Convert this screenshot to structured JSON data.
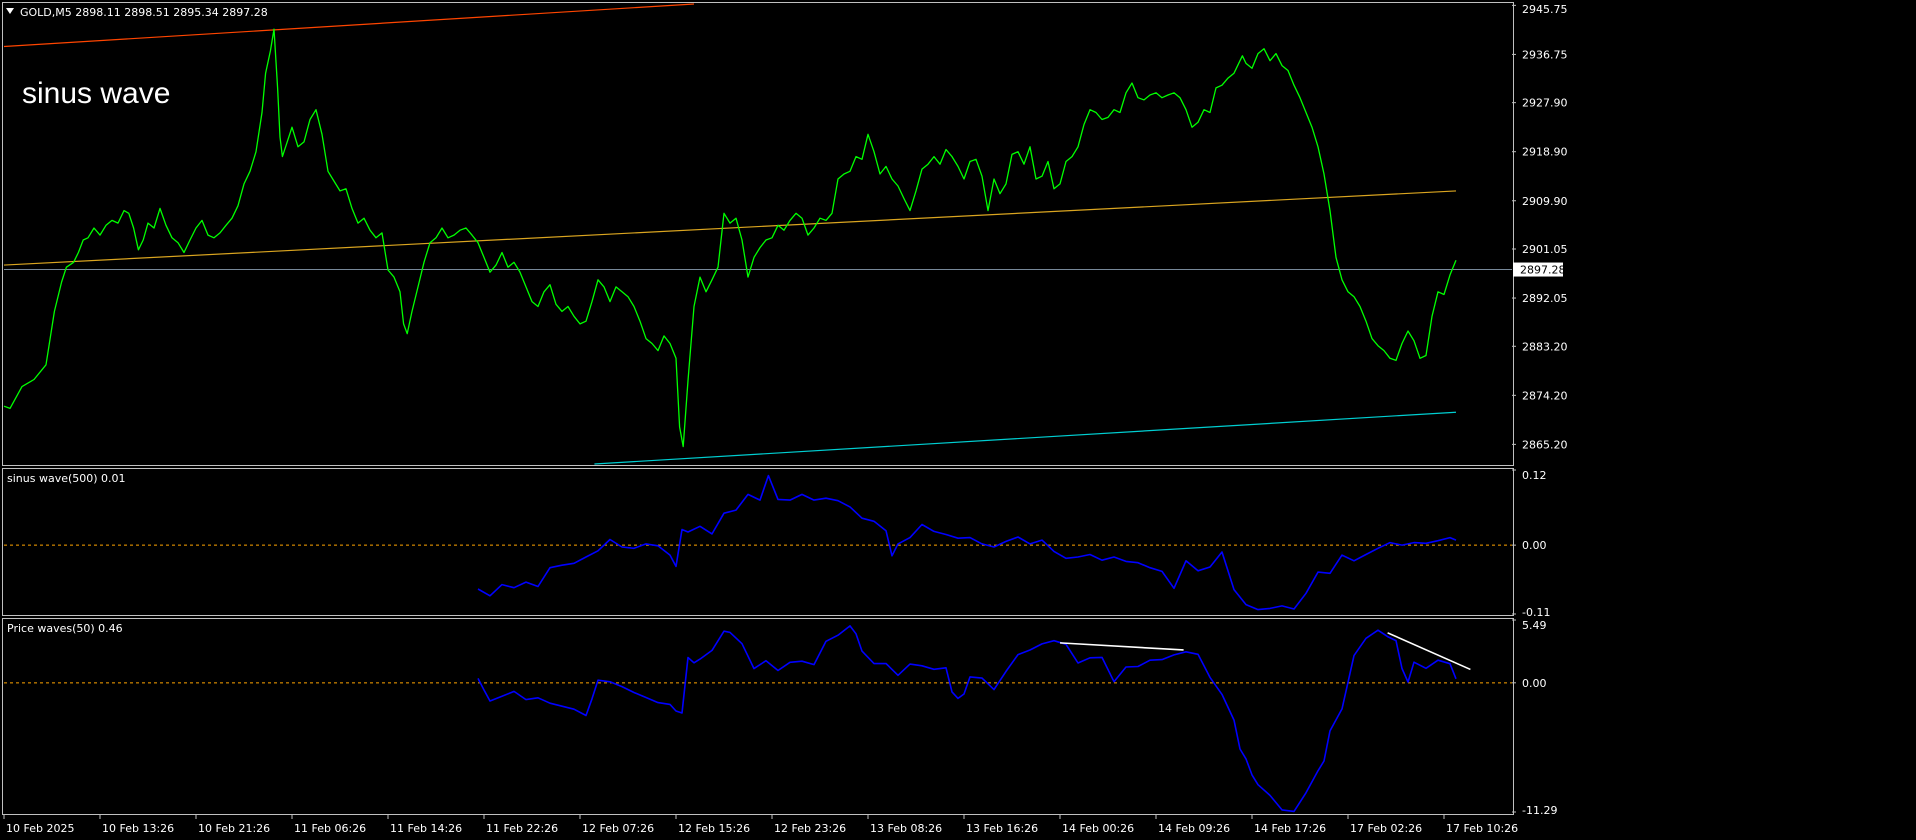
{
  "header": {
    "symbol_line": "GOLD,M5  2898.11 2898.51 2895.34 2897.28",
    "indicator_title": "sinus wave"
  },
  "colors": {
    "background": "#000000",
    "price": "#00ff00",
    "indicator": "#0000ff",
    "zero_line": "#ffa500",
    "divergence": "#ffffff",
    "resistance": "#ff4500",
    "midline": "#daa520",
    "support": "#00ced1",
    "current_price_line": "#778899"
  },
  "x_axis": {
    "labels": [
      "10 Feb 2025",
      "10 Feb 13:26",
      "10 Feb 21:26",
      "11 Feb 06:26",
      "11 Feb 14:26",
      "11 Feb 22:26",
      "12 Feb 07:26",
      "12 Feb 15:26",
      "12 Feb 23:26",
      "13 Feb 08:26",
      "13 Feb 16:26",
      "14 Feb 00:26",
      "14 Feb 09:26",
      "14 Feb 17:26",
      "17 Feb 02:26",
      "17 Feb 10:26"
    ]
  },
  "chart_data": [
    {
      "type": "line",
      "name": "main",
      "title": "GOLD,M5  2898.11 2898.51 2895.34 2897.28",
      "ylim": [
        2861.6,
        2946.0
      ],
      "y_ticks": [
        "2945.75",
        "2936.75",
        "2927.90",
        "2918.90",
        "2909.90",
        "2901.05",
        "2892.05",
        "2883.20",
        "2874.20",
        "2865.20"
      ],
      "current_price": "2897.28",
      "x": [
        0,
        5,
        15,
        25,
        35,
        42,
        48,
        52,
        58,
        62,
        66,
        70,
        75,
        80,
        85,
        90,
        95,
        100,
        104,
        108,
        112,
        116,
        120,
        125,
        130,
        135,
        140,
        145,
        150,
        155,
        160,
        165,
        170,
        175,
        180,
        185,
        190,
        195,
        200,
        205,
        210,
        215,
        218,
        222,
        225,
        228,
        230,
        232,
        236,
        240,
        245,
        250,
        255,
        260,
        265,
        270,
        275,
        280,
        285,
        290,
        295,
        300,
        305,
        310,
        315,
        320,
        325,
        330,
        333,
        336,
        340,
        345,
        350,
        355,
        360,
        365,
        370,
        375,
        380,
        385,
        390,
        395,
        400,
        405,
        410,
        415,
        420,
        425,
        430,
        435,
        440,
        445,
        450,
        455,
        460,
        465,
        470,
        475,
        480,
        485,
        490,
        495,
        500,
        505,
        510,
        515,
        520,
        525,
        530,
        535,
        540,
        545,
        550,
        555,
        560,
        563,
        566,
        570,
        575,
        580,
        585,
        590,
        595,
        600,
        605,
        610,
        615,
        620,
        625,
        630,
        635,
        640,
        645,
        650,
        655,
        660,
        665,
        670,
        675,
        680,
        685,
        690,
        695,
        700,
        705,
        710,
        715,
        720,
        725,
        730,
        735,
        740,
        745,
        750,
        755,
        760,
        765,
        770,
        775,
        780,
        785,
        790,
        795,
        800,
        805,
        810,
        815,
        820,
        825,
        830,
        835,
        840,
        845,
        850,
        855,
        860,
        865,
        870,
        875,
        880,
        885,
        890,
        895,
        900,
        905,
        910,
        915,
        920,
        925,
        930,
        935,
        940,
        945,
        950,
        955,
        960,
        965,
        970,
        975,
        980,
        985,
        990,
        995,
        1000,
        1005,
        1010,
        1015,
        1020,
        1025,
        1030,
        1032,
        1035,
        1040,
        1045,
        1050,
        1055,
        1060,
        1065,
        1070,
        1075,
        1080,
        1085,
        1090,
        1095,
        1100,
        1105,
        1110,
        1115,
        1120,
        1125,
        1130,
        1135,
        1140,
        1145,
        1150,
        1155,
        1160,
        1165,
        1170,
        1175,
        1180,
        1185,
        1190,
        1195,
        1200,
        1205,
        1210
      ],
      "series": [
        {
          "values": [
            2872.2,
            2871.8,
            2875.8,
            2877.1,
            2879.8,
            2889.6,
            2895.0,
            2897.7,
            2898.6,
            2900.4,
            2902.7,
            2903.1,
            2904.9,
            2903.6,
            2905.4,
            2906.3,
            2905.8,
            2908.1,
            2907.6,
            2904.9,
            2900.9,
            2902.7,
            2905.8,
            2904.9,
            2908.5,
            2905.4,
            2903.1,
            2902.2,
            2900.4,
            2902.7,
            2904.9,
            2906.3,
            2903.6,
            2903.1,
            2904.0,
            2905.4,
            2906.7,
            2909.0,
            2913.0,
            2915.3,
            2918.9,
            2926.1,
            2933.3,
            2937.4,
            2941.4,
            2930.6,
            2921.6,
            2918.0,
            2920.7,
            2923.4,
            2919.8,
            2920.7,
            2924.8,
            2926.6,
            2922.1,
            2915.3,
            2913.5,
            2911.7,
            2912.1,
            2908.5,
            2905.8,
            2906.7,
            2904.5,
            2903.1,
            2904.0,
            2897.2,
            2895.9,
            2893.2,
            2887.3,
            2885.5,
            2889.6,
            2894.1,
            2898.6,
            2902.2,
            2903.1,
            2904.9,
            2903.1,
            2903.6,
            2904.5,
            2904.9,
            2903.6,
            2902.2,
            2899.5,
            2896.8,
            2898.1,
            2900.4,
            2897.7,
            2898.6,
            2896.8,
            2894.1,
            2891.4,
            2890.5,
            2893.2,
            2894.5,
            2890.9,
            2889.6,
            2890.5,
            2888.7,
            2887.3,
            2887.8,
            2891.4,
            2895.4,
            2894.1,
            2891.4,
            2894.1,
            2893.2,
            2892.3,
            2890.5,
            2887.8,
            2884.6,
            2883.7,
            2882.4,
            2885.1,
            2883.7,
            2881.0,
            2868.4,
            2864.8,
            2876.9,
            2890.5,
            2895.9,
            2893.2,
            2895.4,
            2897.7,
            2907.6,
            2905.8,
            2906.7,
            2902.7,
            2895.9,
            2899.5,
            2901.3,
            2902.7,
            2903.1,
            2905.4,
            2904.5,
            2906.3,
            2907.6,
            2906.7,
            2903.6,
            2904.9,
            2906.7,
            2906.3,
            2907.6,
            2913.9,
            2914.8,
            2915.3,
            2918.0,
            2917.5,
            2922.1,
            2918.9,
            2914.8,
            2916.2,
            2913.9,
            2912.6,
            2910.3,
            2908.1,
            2911.7,
            2915.7,
            2916.6,
            2918.0,
            2916.6,
            2919.3,
            2918.0,
            2916.2,
            2913.9,
            2917.1,
            2917.5,
            2914.4,
            2908.1,
            2913.9,
            2911.2,
            2913.0,
            2918.4,
            2918.9,
            2916.6,
            2919.8,
            2913.9,
            2914.4,
            2917.1,
            2912.1,
            2913.0,
            2917.1,
            2918.0,
            2919.8,
            2923.9,
            2926.6,
            2926.1,
            2924.8,
            2925.2,
            2926.6,
            2926.1,
            2929.7,
            2931.5,
            2928.8,
            2928.4,
            2929.3,
            2929.7,
            2928.8,
            2929.3,
            2929.7,
            2928.8,
            2926.6,
            2923.4,
            2924.3,
            2926.6,
            2926.1,
            2930.6,
            2931.1,
            2932.4,
            2933.3,
            2935.6,
            2936.5,
            2935.1,
            2934.2,
            2936.9,
            2937.8,
            2935.6,
            2936.9,
            2934.7,
            2933.8,
            2931.1,
            2928.8,
            2926.1,
            2923.4,
            2919.8,
            2914.8,
            2908.1,
            2899.5,
            2895.4,
            2893.2,
            2892.3,
            2890.5,
            2887.8,
            2884.6,
            2883.3,
            2882.4,
            2881.0,
            2880.6,
            2883.7,
            2886.0,
            2884.2,
            2881.0,
            2881.5,
            2888.7,
            2893.2,
            2892.7,
            2896.3,
            2899.0,
            2900.8,
            2902.2,
            2904.9,
            2903.1,
            2901.7,
            2899.9,
            2895.9,
            2897.2,
            2893.6,
            2898.6,
            2900.4,
            2899.5,
            2902.2,
            2902.2,
            2904.5,
            2903.1,
            2896.8
          ]
        }
      ],
      "trendlines": [
        {
          "name": "resistance",
          "x": [
            0,
            575
          ],
          "y": [
            2938.2,
            2946.0
          ]
        },
        {
          "name": "midline",
          "x": [
            0,
            1210
          ],
          "y": [
            2898.1,
            2911.7
          ]
        },
        {
          "name": "support",
          "x": [
            492,
            1210
          ],
          "y": [
            2861.6,
            2871.1
          ]
        }
      ]
    },
    {
      "type": "line",
      "name": "sinus_wave",
      "title": "sinus wave(500) 0.01",
      "ylim": [
        -0.11,
        0.12
      ],
      "y_ticks": [
        "0.12",
        "0.00",
        "-0.11"
      ],
      "zero_line": 0,
      "x": [
        395,
        405,
        415,
        425,
        435,
        445,
        455,
        465,
        475,
        485,
        495,
        505,
        515,
        525,
        535,
        545,
        555,
        560,
        565,
        570,
        580,
        590,
        600,
        610,
        620,
        630,
        637,
        645,
        655,
        665,
        675,
        685,
        695,
        705,
        715,
        725,
        735,
        740,
        745,
        755,
        765,
        775,
        785,
        795,
        805,
        815,
        825,
        835,
        845,
        855,
        865,
        875,
        885,
        895,
        905,
        915,
        925,
        935,
        945,
        955,
        965,
        975,
        985,
        995,
        1005,
        1015,
        1025,
        1035,
        1045,
        1055,
        1065,
        1075,
        1085,
        1095,
        1105,
        1115,
        1125,
        1135,
        1145,
        1155,
        1165,
        1175,
        1185,
        1195,
        1205,
        1210
      ],
      "series": [
        {
          "values": [
            -0.07,
            -0.081,
            -0.063,
            -0.068,
            -0.059,
            -0.066,
            -0.036,
            -0.032,
            -0.029,
            -0.019,
            -0.009,
            0.009,
            -0.003,
            -0.005,
            0.002,
            -0.001,
            -0.016,
            -0.034,
            0.025,
            0.021,
            0.03,
            0.018,
            0.051,
            0.056,
            0.081,
            0.072,
            0.111,
            0.073,
            0.072,
            0.081,
            0.072,
            0.075,
            0.071,
            0.061,
            0.043,
            0.038,
            0.023,
            -0.017,
            0.002,
            0.012,
            0.033,
            0.022,
            0.017,
            0.011,
            0.012,
            0.002,
            -0.003,
            0.006,
            0.013,
            0.002,
            0.008,
            -0.01,
            -0.021,
            -0.019,
            -0.015,
            -0.024,
            -0.019,
            -0.026,
            -0.028,
            -0.036,
            -0.042,
            -0.069,
            -0.025,
            -0.041,
            -0.035,
            -0.011,
            -0.071,
            -0.095,
            -0.103,
            -0.101,
            -0.097,
            -0.102,
            -0.077,
            -0.043,
            -0.045,
            -0.016,
            -0.025,
            -0.015,
            -0.005,
            0.004,
            0.0,
            0.004,
            0.003,
            0.007,
            0.012,
            0.008
          ]
        }
      ]
    },
    {
      "type": "line",
      "name": "price_waves",
      "title": "Price waves(50) 0.46",
      "ylim": [
        -11.29,
        5.49
      ],
      "y_ticks": [
        "5.49",
        "0.00",
        "-11.29"
      ],
      "zero_line": 0,
      "x": [
        395,
        400,
        405,
        415,
        425,
        435,
        445,
        455,
        465,
        475,
        485,
        490,
        495,
        505,
        515,
        525,
        535,
        545,
        555,
        560,
        565,
        570,
        575,
        580,
        590,
        600,
        605,
        615,
        625,
        635,
        645,
        655,
        665,
        675,
        685,
        695,
        705,
        710,
        715,
        725,
        735,
        745,
        755,
        765,
        775,
        785,
        790,
        795,
        800,
        805,
        815,
        825,
        835,
        845,
        855,
        865,
        875,
        885,
        895,
        905,
        915,
        925,
        935,
        945,
        955,
        965,
        975,
        985,
        995,
        1005,
        1015,
        1025,
        1030,
        1035,
        1040,
        1045,
        1055,
        1065,
        1075,
        1085,
        1095,
        1100,
        1105,
        1115,
        1125,
        1135,
        1145,
        1153,
        1160,
        1165,
        1170,
        1175,
        1185,
        1195,
        1205,
        1210
      ],
      "series": [
        {
          "values": [
            0.39,
            -0.63,
            -1.59,
            -1.18,
            -0.75,
            -1.47,
            -1.31,
            -1.78,
            -2.04,
            -2.31,
            -2.86,
            -1.4,
            0.23,
            0.09,
            -0.33,
            -0.85,
            -1.28,
            -1.73,
            -1.89,
            -2.46,
            -2.64,
            2.21,
            1.75,
            2.07,
            2.83,
            4.51,
            4.41,
            3.42,
            1.24,
            1.93,
            1.08,
            1.79,
            1.89,
            1.59,
            3.63,
            4.16,
            4.97,
            4.28,
            2.77,
            1.68,
            1.69,
            0.66,
            1.64,
            1.49,
            1.18,
            1.31,
            -0.79,
            -1.36,
            -0.98,
            0.52,
            0.41,
            -0.59,
            1.0,
            2.47,
            2.87,
            3.4,
            3.68,
            3.37,
            1.73,
            2.19,
            2.22,
            0.1,
            1.38,
            1.43,
            1.98,
            2.03,
            2.44,
            2.71,
            2.49,
            0.47,
            -1.01,
            -3.26,
            -5.78,
            -6.65,
            -8.05,
            -8.9,
            -9.84,
            -11.11,
            -11.24,
            -9.61,
            -7.69,
            -6.83,
            -4.2,
            -2.28,
            2.38,
            3.89,
            4.6,
            4.04,
            3.69,
            1.25,
            0.06,
            1.8,
            1.27,
            1.98,
            1.67,
            0.35
          ]
        }
      ],
      "divergence_lines": [
        {
          "x": [
            880,
            983
          ],
          "y": [
            3.49,
            2.87
          ]
        },
        {
          "x": [
            1153,
            1222
          ],
          "y": [
            4.37,
            1.17
          ]
        }
      ]
    }
  ]
}
